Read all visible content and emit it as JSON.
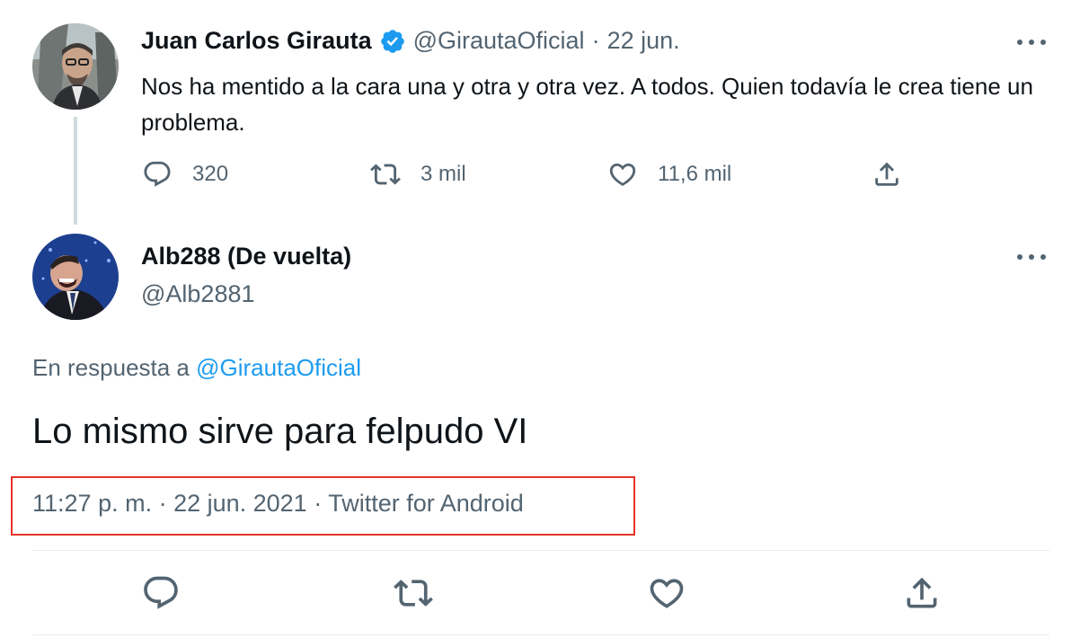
{
  "tweet": {
    "author_name": "Juan Carlos Girauta",
    "handle": "@GirautaOficial",
    "separator": "·",
    "date": "22 jun.",
    "text": "Nos ha mentido a la cara una y otra y otra vez. A todos. Quien todavía le crea tiene un problema.",
    "replies": "320",
    "retweets": "3 mil",
    "likes": "11,6 mil"
  },
  "reply": {
    "author_name": "Alb288 (De vuelta)",
    "handle": "@Alb2881",
    "in_reply_prefix": "En respuesta a",
    "in_reply_mention": "@GirautaOficial",
    "text": "Lo mismo sirve para felpudo VI",
    "timestamp": "11:27 p. m. · 22 jun. 2021 · Twitter for Android"
  },
  "colors": {
    "accent": "#1d9bf0",
    "muted": "#536471",
    "highlight_box": "#e5332a"
  },
  "icons": [
    "reply-icon",
    "retweet-icon",
    "like-icon",
    "share-icon",
    "more-icon",
    "verified-icon"
  ]
}
